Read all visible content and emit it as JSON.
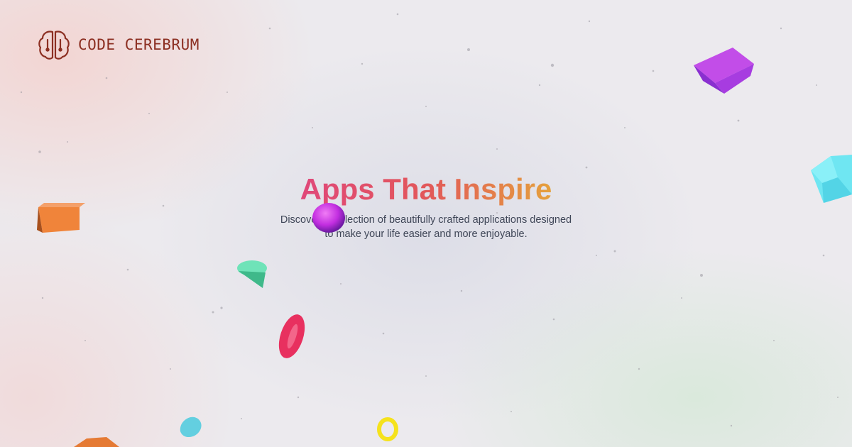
{
  "brand": {
    "name": "CODE CEREBRUM",
    "icon": "brain-icon",
    "color": "#8c2f22"
  },
  "hero": {
    "title": "Apps That Inspire",
    "subtitle": "Discover a collection of beautifully crafted applications designed to make your life easier and more enjoyable.",
    "title_gradient": [
      "#e0487a",
      "#e2575a",
      "#e5a13c"
    ]
  },
  "decorations": {
    "shapes": [
      "purple-cube",
      "cyan-icosahedron",
      "orange-box",
      "magenta-sphere",
      "mint-cone",
      "pink-torus",
      "teal-drop",
      "yellow-ring",
      "orange-wedge"
    ],
    "colors": {
      "purple": "#b43ae0",
      "cyan": "#6fe6f2",
      "orange": "#f0843a",
      "magenta": "#c42ee0",
      "mint": "#5ed9a8",
      "pink": "#e8305f",
      "teal": "#63cfe0",
      "yellow": "#f5e21c"
    }
  }
}
